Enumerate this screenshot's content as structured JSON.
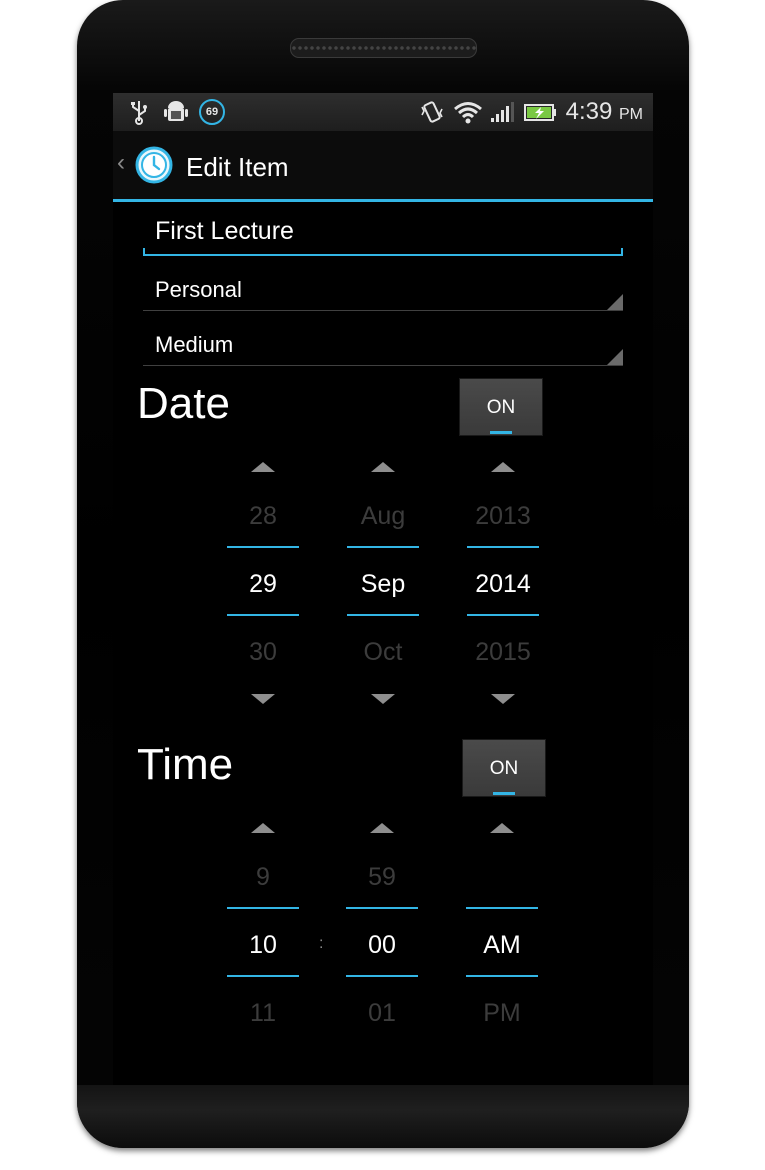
{
  "status_bar": {
    "icons": [
      "usb-icon",
      "android-debug-icon",
      "vibrate-icon",
      "wifi-icon",
      "signal-icon",
      "battery-charging-icon"
    ],
    "notification_badge": "69",
    "time": "4:39",
    "ampm": "PM"
  },
  "action_bar": {
    "title": "Edit Item",
    "back_icon": "chevron-left-icon",
    "app_icon": "clock-icon"
  },
  "form": {
    "name_value": "First Lecture",
    "category_value": "Personal",
    "priority_value": "Medium"
  },
  "date": {
    "label": "Date",
    "toggle": "ON",
    "day": {
      "prev": "28",
      "current": "29",
      "next": "30"
    },
    "month": {
      "prev": "Aug",
      "current": "Sep",
      "next": "Oct"
    },
    "year": {
      "prev": "2013",
      "current": "2014",
      "next": "2015"
    }
  },
  "time": {
    "label": "Time",
    "toggle": "ON",
    "hour": {
      "prev": "9",
      "current": "10",
      "next": "11"
    },
    "separator": ":",
    "minute": {
      "prev": "59",
      "current": "00",
      "next": "01"
    },
    "ampm": {
      "prev": "",
      "current": "AM",
      "next": "PM"
    }
  },
  "colors": {
    "accent": "#33b5e5",
    "background": "#000000",
    "text": "#ffffff",
    "dim_text": "#3c3c3c"
  }
}
